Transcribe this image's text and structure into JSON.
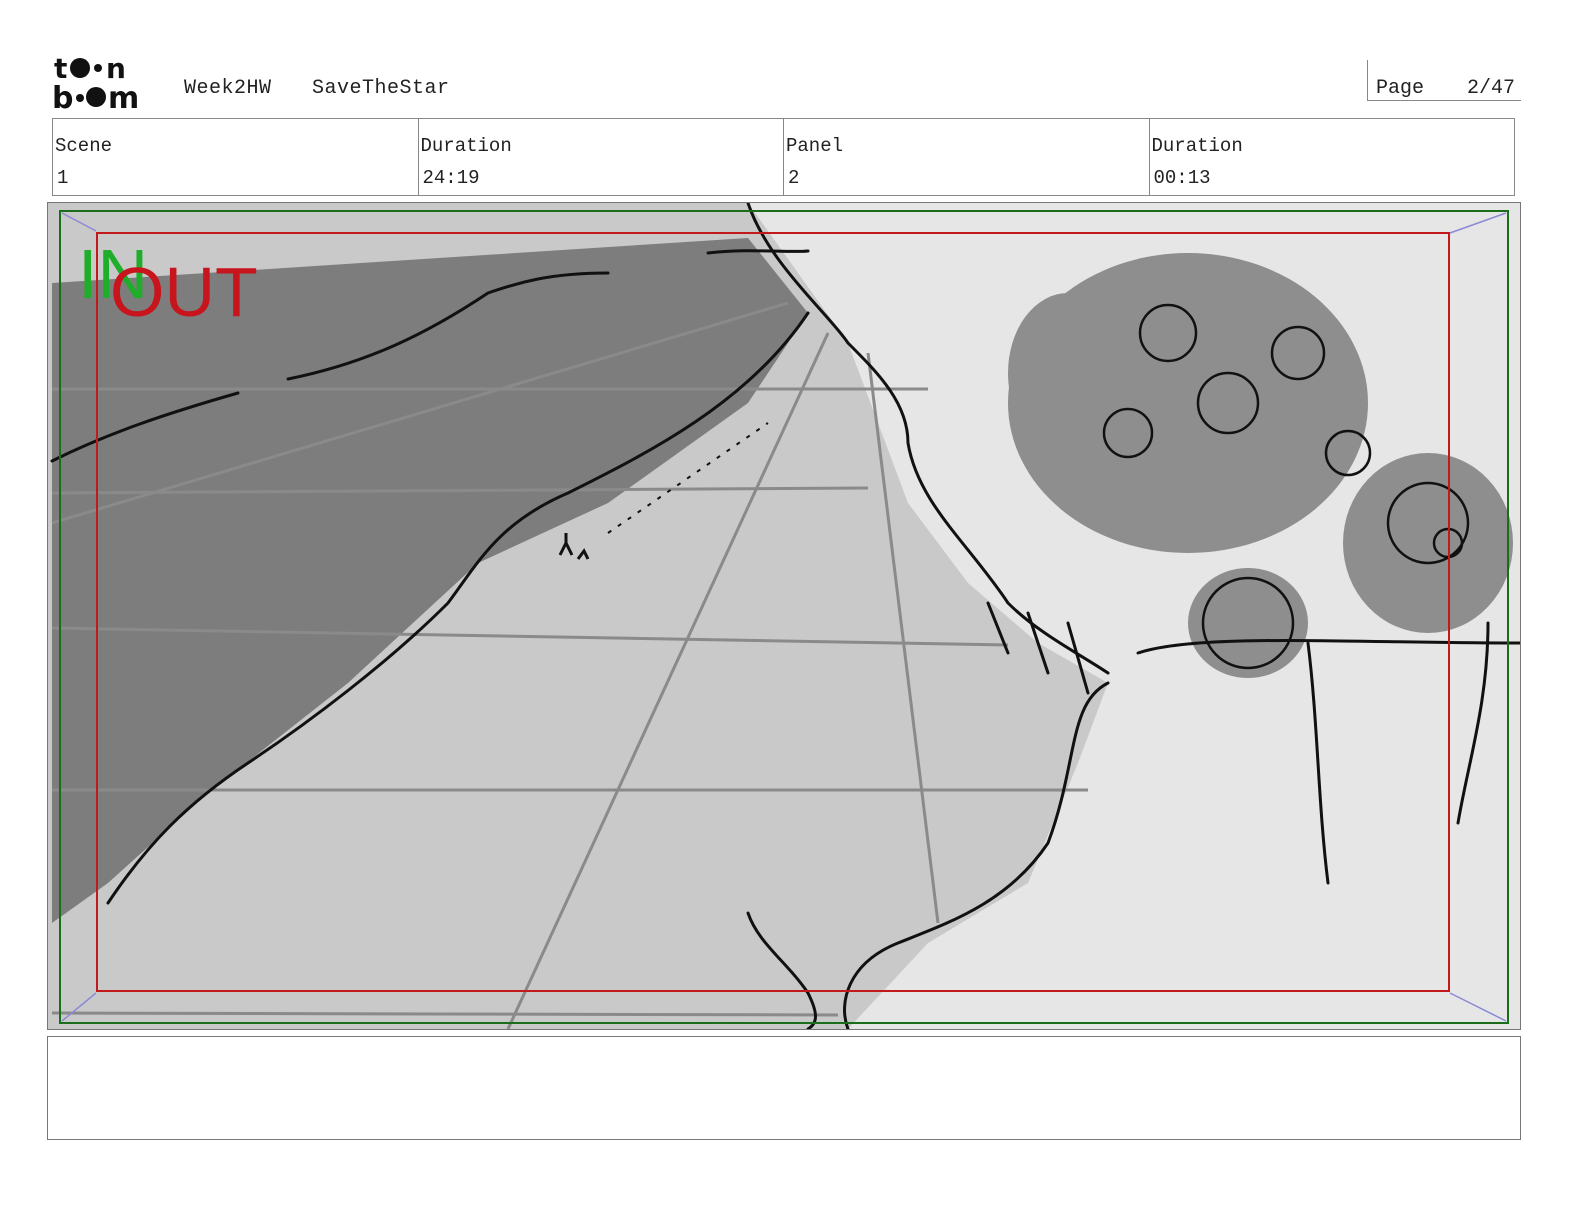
{
  "header": {
    "logo_alt": "toon boom",
    "project": "Week2HW",
    "title": "SaveTheStar",
    "page_label": "Page",
    "page_value": "2/47"
  },
  "info": [
    {
      "label": "Scene",
      "value": "1"
    },
    {
      "label": "Duration",
      "value": "24:19"
    },
    {
      "label": "Panel",
      "value": "2"
    },
    {
      "label": "Duration",
      "value": "00:13"
    }
  ],
  "panel": {
    "in_label": "IN",
    "out_label": "OUT",
    "colors": {
      "in": "#1fae2a",
      "out": "#c8141c",
      "safe_frame": "#1a6e1a",
      "title_safe": "#c01a1a"
    }
  },
  "notes": {
    "text": ""
  }
}
